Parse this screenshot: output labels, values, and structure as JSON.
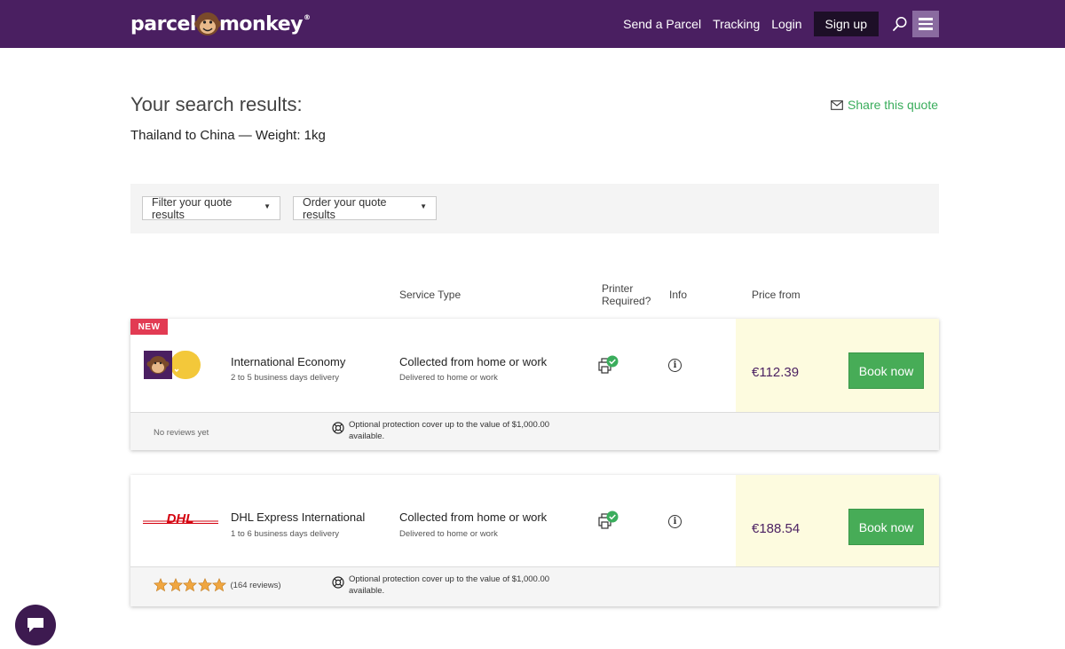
{
  "header": {
    "logo_left": "parcel",
    "logo_right": "monkey",
    "logo_reg": "®",
    "nav": {
      "send": "Send a Parcel",
      "tracking": "Tracking",
      "login": "Login",
      "signup": "Sign up"
    },
    "icons": [
      "search-icon",
      "cart-icon",
      "hamburger-menu-icon"
    ],
    "colors": {
      "bar": "#4a1f61",
      "signup": "#1d0f27",
      "menu": "#8a6ba0",
      "cart": "#e84a5f"
    }
  },
  "page": {
    "title": "Your search results:",
    "route": "Thailand to China — Weight: 1kg",
    "share": "Share this quote"
  },
  "filters": {
    "filter_label": "Filter your quote results",
    "order_label": "Order your quote results"
  },
  "columns": {
    "service_type": "Service Type",
    "printer_1": "Printer",
    "printer_2": "Required?",
    "info": "Info",
    "price_from": "Price from"
  },
  "quotes": [
    {
      "badge": "NEW",
      "logo": "parcel-monkey-logo",
      "service": "International Economy",
      "delivery": "2 to 5 business days delivery",
      "type": "Collected from home or work",
      "type_sub": "Delivered to home or work",
      "price": "€112.39",
      "book": "Book now",
      "reviews": "No reviews yet",
      "protection_1": "Optional protection cover up to the value of $1,000.00",
      "protection_2": "available."
    },
    {
      "logo": "dhl-logo",
      "logo_text": "DHL",
      "service": "DHL Express International",
      "delivery": "1 to 6 business days delivery",
      "type": "Collected from home or work",
      "type_sub": "Delivered to home or work",
      "price": "€188.54",
      "book": "Book now",
      "rating_stars": 5,
      "reviews": "(164 reviews)",
      "protection_1": "Optional protection cover up to the value of $1,000.00",
      "protection_2": "available."
    }
  ],
  "colors": {
    "accent_green": "#3aad5c",
    "book_button": "#47ac57",
    "price_bg": "#fdfbdf",
    "price_text": "#4a1f61",
    "new_badge": "#e23b53",
    "dhl_red": "#d40511",
    "star": "#f0a640"
  }
}
